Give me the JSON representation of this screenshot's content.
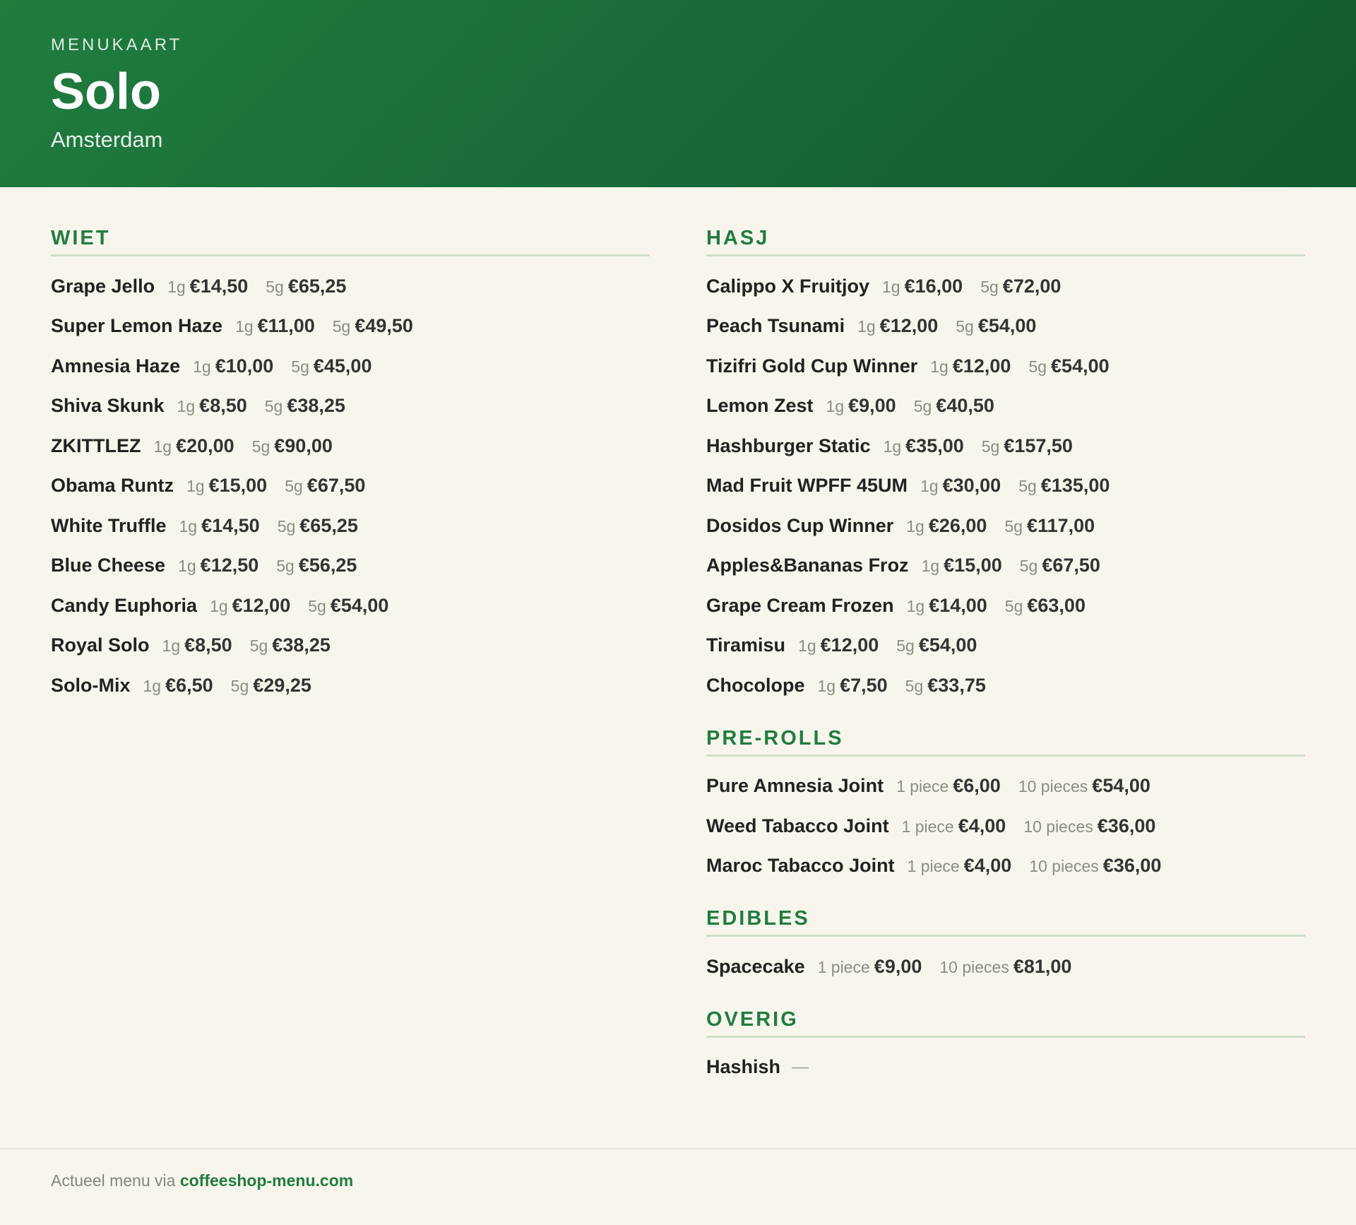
{
  "header": {
    "eyebrow": "MENUKAART",
    "shop_name": "Solo",
    "city": "Amsterdam"
  },
  "columns": [
    {
      "sections": [
        {
          "title": "WIET",
          "items": [
            {
              "name": "Grape Jello",
              "prices": [
                {
                  "unit": "1g",
                  "price": "€14,50"
                },
                {
                  "unit": "5g",
                  "price": "€65,25"
                }
              ]
            },
            {
              "name": "Super Lemon Haze",
              "prices": [
                {
                  "unit": "1g",
                  "price": "€11,00"
                },
                {
                  "unit": "5g",
                  "price": "€49,50"
                }
              ]
            },
            {
              "name": "Amnesia Haze",
              "prices": [
                {
                  "unit": "1g",
                  "price": "€10,00"
                },
                {
                  "unit": "5g",
                  "price": "€45,00"
                }
              ]
            },
            {
              "name": "Shiva Skunk",
              "prices": [
                {
                  "unit": "1g",
                  "price": "€8,50"
                },
                {
                  "unit": "5g",
                  "price": "€38,25"
                }
              ]
            },
            {
              "name": "ZKITTLEZ",
              "prices": [
                {
                  "unit": "1g",
                  "price": "€20,00"
                },
                {
                  "unit": "5g",
                  "price": "€90,00"
                }
              ]
            },
            {
              "name": "Obama Runtz",
              "prices": [
                {
                  "unit": "1g",
                  "price": "€15,00"
                },
                {
                  "unit": "5g",
                  "price": "€67,50"
                }
              ]
            },
            {
              "name": "White Truffle",
              "prices": [
                {
                  "unit": "1g",
                  "price": "€14,50"
                },
                {
                  "unit": "5g",
                  "price": "€65,25"
                }
              ]
            },
            {
              "name": "Blue Cheese",
              "prices": [
                {
                  "unit": "1g",
                  "price": "€12,50"
                },
                {
                  "unit": "5g",
                  "price": "€56,25"
                }
              ]
            },
            {
              "name": "Candy Euphoria",
              "prices": [
                {
                  "unit": "1g",
                  "price": "€12,00"
                },
                {
                  "unit": "5g",
                  "price": "€54,00"
                }
              ]
            },
            {
              "name": "Royal Solo",
              "prices": [
                {
                  "unit": "1g",
                  "price": "€8,50"
                },
                {
                  "unit": "5g",
                  "price": "€38,25"
                }
              ]
            },
            {
              "name": "Solo-Mix",
              "prices": [
                {
                  "unit": "1g",
                  "price": "€6,50"
                },
                {
                  "unit": "5g",
                  "price": "€29,25"
                }
              ]
            }
          ]
        }
      ]
    },
    {
      "sections": [
        {
          "title": "HASJ",
          "items": [
            {
              "name": "Calippo X Fruitjoy",
              "prices": [
                {
                  "unit": "1g",
                  "price": "€16,00"
                },
                {
                  "unit": "5g",
                  "price": "€72,00"
                }
              ]
            },
            {
              "name": "Peach Tsunami",
              "prices": [
                {
                  "unit": "1g",
                  "price": "€12,00"
                },
                {
                  "unit": "5g",
                  "price": "€54,00"
                }
              ]
            },
            {
              "name": "Tizifri Gold Cup Winner",
              "prices": [
                {
                  "unit": "1g",
                  "price": "€12,00"
                },
                {
                  "unit": "5g",
                  "price": "€54,00"
                }
              ]
            },
            {
              "name": "Lemon Zest",
              "prices": [
                {
                  "unit": "1g",
                  "price": "€9,00"
                },
                {
                  "unit": "5g",
                  "price": "€40,50"
                }
              ]
            },
            {
              "name": "Hashburger Static",
              "prices": [
                {
                  "unit": "1g",
                  "price": "€35,00"
                },
                {
                  "unit": "5g",
                  "price": "€157,50"
                }
              ]
            },
            {
              "name": "Mad Fruit WPFF 45UM",
              "prices": [
                {
                  "unit": "1g",
                  "price": "€30,00"
                },
                {
                  "unit": "5g",
                  "price": "€135,00"
                }
              ]
            },
            {
              "name": "Dosidos Cup Winner",
              "prices": [
                {
                  "unit": "1g",
                  "price": "€26,00"
                },
                {
                  "unit": "5g",
                  "price": "€117,00"
                }
              ]
            },
            {
              "name": "Apples&Bananas Froz",
              "prices": [
                {
                  "unit": "1g",
                  "price": "€15,00"
                },
                {
                  "unit": "5g",
                  "price": "€67,50"
                }
              ]
            },
            {
              "name": "Grape Cream Frozen",
              "prices": [
                {
                  "unit": "1g",
                  "price": "€14,00"
                },
                {
                  "unit": "5g",
                  "price": "€63,00"
                }
              ]
            },
            {
              "name": "Tiramisu",
              "prices": [
                {
                  "unit": "1g",
                  "price": "€12,00"
                },
                {
                  "unit": "5g",
                  "price": "€54,00"
                }
              ]
            },
            {
              "name": "Chocolope",
              "prices": [
                {
                  "unit": "1g",
                  "price": "€7,50"
                },
                {
                  "unit": "5g",
                  "price": "€33,75"
                }
              ]
            }
          ]
        },
        {
          "title": "PRE-ROLLS",
          "items": [
            {
              "name": "Pure Amnesia Joint",
              "prices": [
                {
                  "unit": "1 piece",
                  "price": "€6,00"
                },
                {
                  "unit": "10 pieces",
                  "price": "€54,00"
                }
              ]
            },
            {
              "name": "Weed Tabacco Joint",
              "prices": [
                {
                  "unit": "1 piece",
                  "price": "€4,00"
                },
                {
                  "unit": "10 pieces",
                  "price": "€36,00"
                }
              ]
            },
            {
              "name": "Maroc Tabacco Joint",
              "prices": [
                {
                  "unit": "1 piece",
                  "price": "€4,00"
                },
                {
                  "unit": "10 pieces",
                  "price": "€36,00"
                }
              ]
            }
          ]
        },
        {
          "title": "EDIBLES",
          "items": [
            {
              "name": "Spacecake",
              "prices": [
                {
                  "unit": "1 piece",
                  "price": "€9,00"
                },
                {
                  "unit": "10 pieces",
                  "price": "€81,00"
                }
              ]
            }
          ]
        },
        {
          "title": "OVERIG",
          "items": [
            {
              "name": "Hashish",
              "prices": [],
              "empty_marker": "—"
            }
          ]
        }
      ]
    }
  ],
  "footer": {
    "prefix": "Actueel menu via ",
    "link_text": "coffeeshop-menu.com"
  },
  "colors": {
    "brand_green": "#207d3e",
    "background": "#f8f6ec",
    "divider": "#cfdfc8"
  }
}
